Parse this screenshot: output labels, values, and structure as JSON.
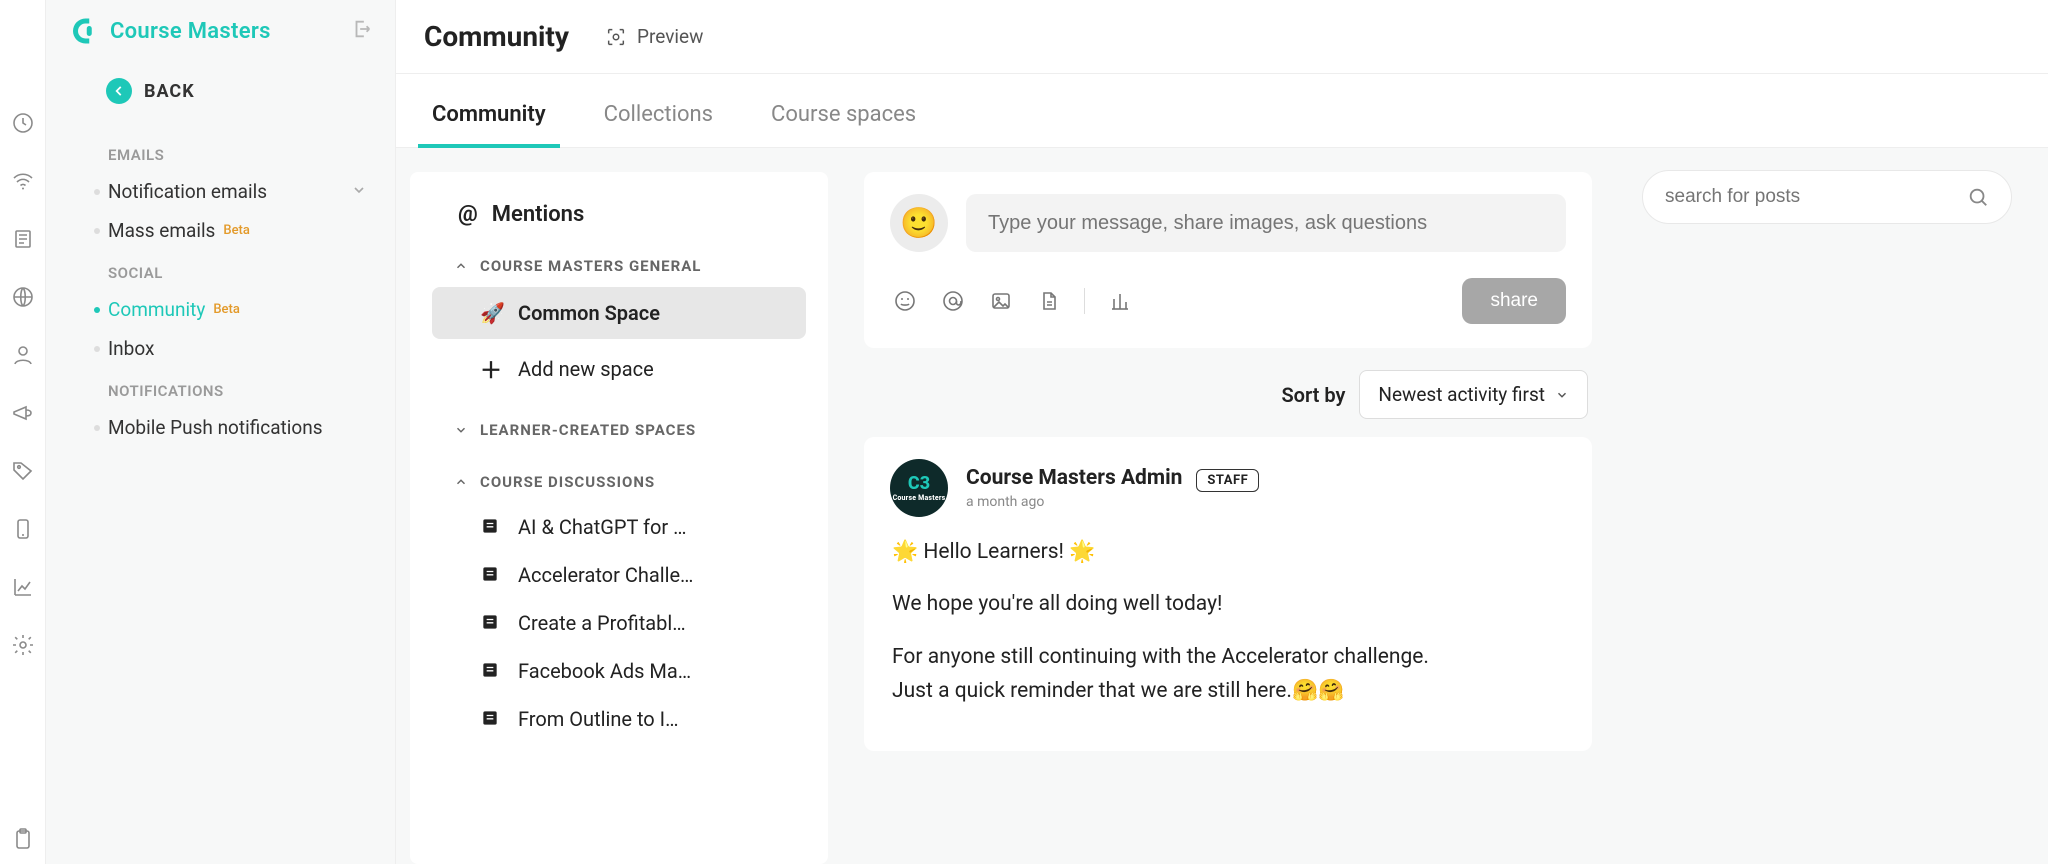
{
  "brand": {
    "name": "Course Masters"
  },
  "back_label": "BACK",
  "sidebar": {
    "sections": [
      {
        "heading": "EMAILS",
        "items": [
          {
            "label": "Notification emails",
            "beta": "",
            "chevron": true
          },
          {
            "label": "Mass emails",
            "beta": "Beta"
          }
        ]
      },
      {
        "heading": "SOCIAL",
        "items": [
          {
            "label": "Community",
            "beta": "Beta",
            "active": true
          },
          {
            "label": "Inbox"
          }
        ]
      },
      {
        "heading": "NOTIFICATIONS",
        "items": [
          {
            "label": "Mobile Push notifications"
          }
        ]
      }
    ]
  },
  "page": {
    "title": "Community",
    "preview": "Preview"
  },
  "tabs": [
    {
      "label": "Community",
      "active": true
    },
    {
      "label": "Collections"
    },
    {
      "label": "Course spaces"
    }
  ],
  "spaces": {
    "mentions": "Mentions",
    "group1_head": "COURSE MASTERS GENERAL",
    "common_space": "Common Space",
    "add_space": "Add new space",
    "group2_head": "LEARNER-CREATED SPACES",
    "group3_head": "COURSE DISCUSSIONS",
    "courses": [
      "AI & ChatGPT for …",
      "Accelerator Challe…",
      "Create a Profitabl…",
      "Facebook Ads Ma…",
      "From Outline to I…"
    ]
  },
  "composer": {
    "placeholder": "Type your message, share images, ask questions",
    "share": "share"
  },
  "sort": {
    "label": "Sort by",
    "value": "Newest activity first"
  },
  "post": {
    "author": "Course Masters Admin",
    "badge": "STAFF",
    "time": "a month ago",
    "p1": "🌟 Hello Learners! 🌟",
    "p2": "We hope you're all doing well today!",
    "p3": "For anyone still continuing with the Accelerator challenge.",
    "p4": "Just a quick reminder that we are still here.🤗🤗"
  },
  "search": {
    "placeholder": "search for posts"
  }
}
